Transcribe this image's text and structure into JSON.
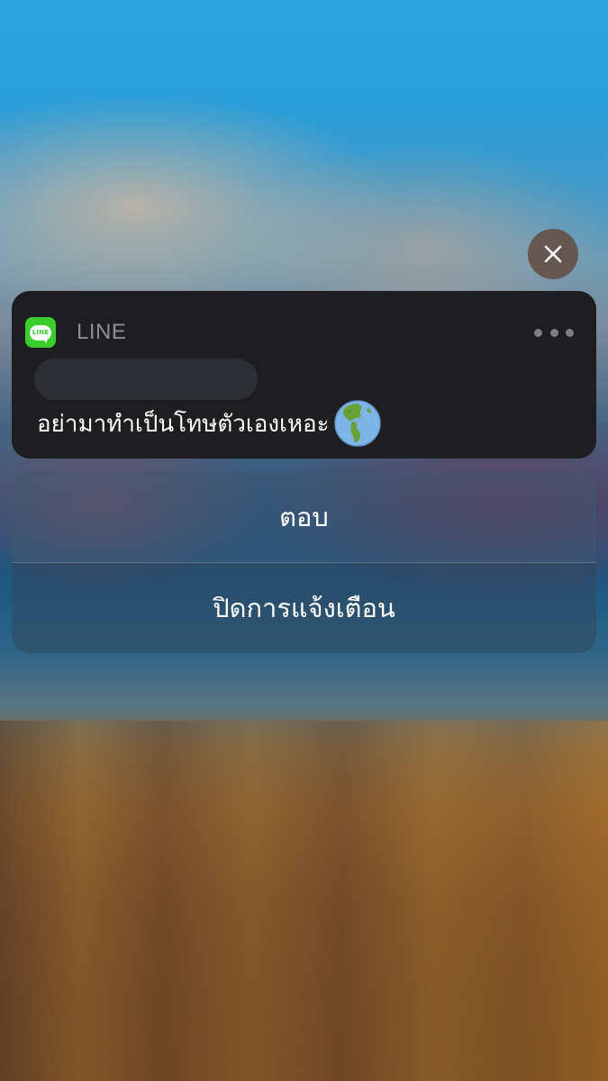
{
  "notification": {
    "app_name": "LINE",
    "app_icon_text": "LINE",
    "app_icon": "line-app-icon",
    "message": "อย่ามาทำเป็นโทษตัวเองเหอะ",
    "emoji": "globe-americas-icon",
    "more_icon": "ellipsis-icon",
    "sender_redacted": true
  },
  "close_button": {
    "icon": "close-icon"
  },
  "actions": {
    "reply_label": "ตอบ",
    "disable_label": "ปิดการแจ้งเตือน"
  },
  "colors": {
    "line_green": "#3acd2c",
    "card_background": "#1e1e20",
    "app_name_gray": "#8e8e92"
  }
}
